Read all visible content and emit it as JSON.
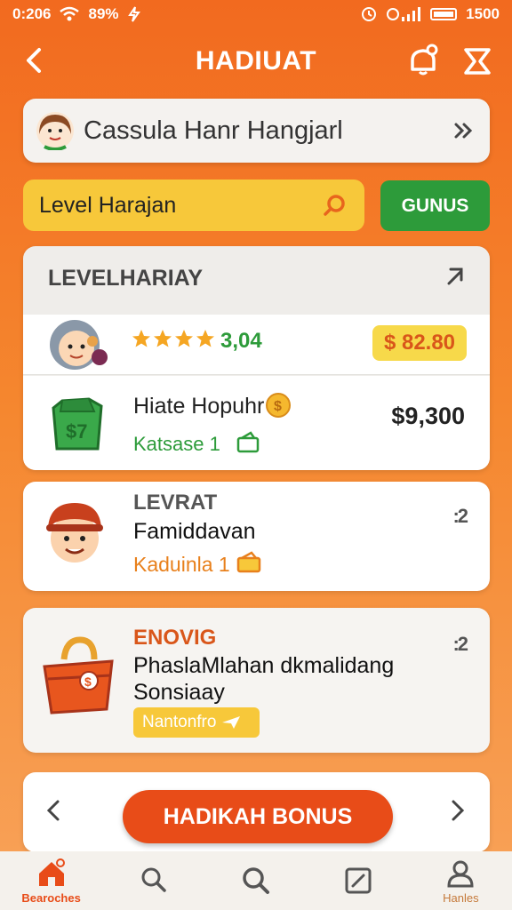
{
  "status_bar": {
    "time_left": "0:206",
    "battery_pct": "89%",
    "time_right": "1500"
  },
  "header": {
    "title": "HADIUAT"
  },
  "userbar": {
    "name": "Cassula Hanr Hangjarl"
  },
  "level": {
    "label": "Level Harajan",
    "button_label": "GUNUS"
  },
  "panel": {
    "title": "LEVELHARIAY",
    "rating": "3,04",
    "stars": 4,
    "price_badge": "$ 82.80",
    "item_name": "Hiate Hopuhr",
    "item_sub": "Katsase 1",
    "item_amount": "$9,300"
  },
  "card1": {
    "kicker": "LEVRAT",
    "title": "Famiddavan",
    "sub": "Kaduinla 1",
    "more": ":2"
  },
  "card2": {
    "kicker": "ENOVIG",
    "title": "PhaslaMlahan dkmalidang Sonsiaay",
    "tag": "Nantonfro",
    "more": ":2"
  },
  "bonus": {
    "button_label": "HADIKAH BONUS"
  },
  "bottom_nav": {
    "items": [
      {
        "label": "Bearoches",
        "icon": "home-icon"
      },
      {
        "label": "",
        "icon": "search-icon"
      },
      {
        "label": "",
        "icon": "search-icon"
      },
      {
        "label": "",
        "icon": "edit-icon"
      },
      {
        "label": "Hanles",
        "icon": "profile-icon"
      }
    ]
  },
  "colors": {
    "brand_orange": "#f26a1f",
    "green": "#2d9b3a",
    "yellow": "#f7c83a",
    "button_red": "#e84c18"
  }
}
